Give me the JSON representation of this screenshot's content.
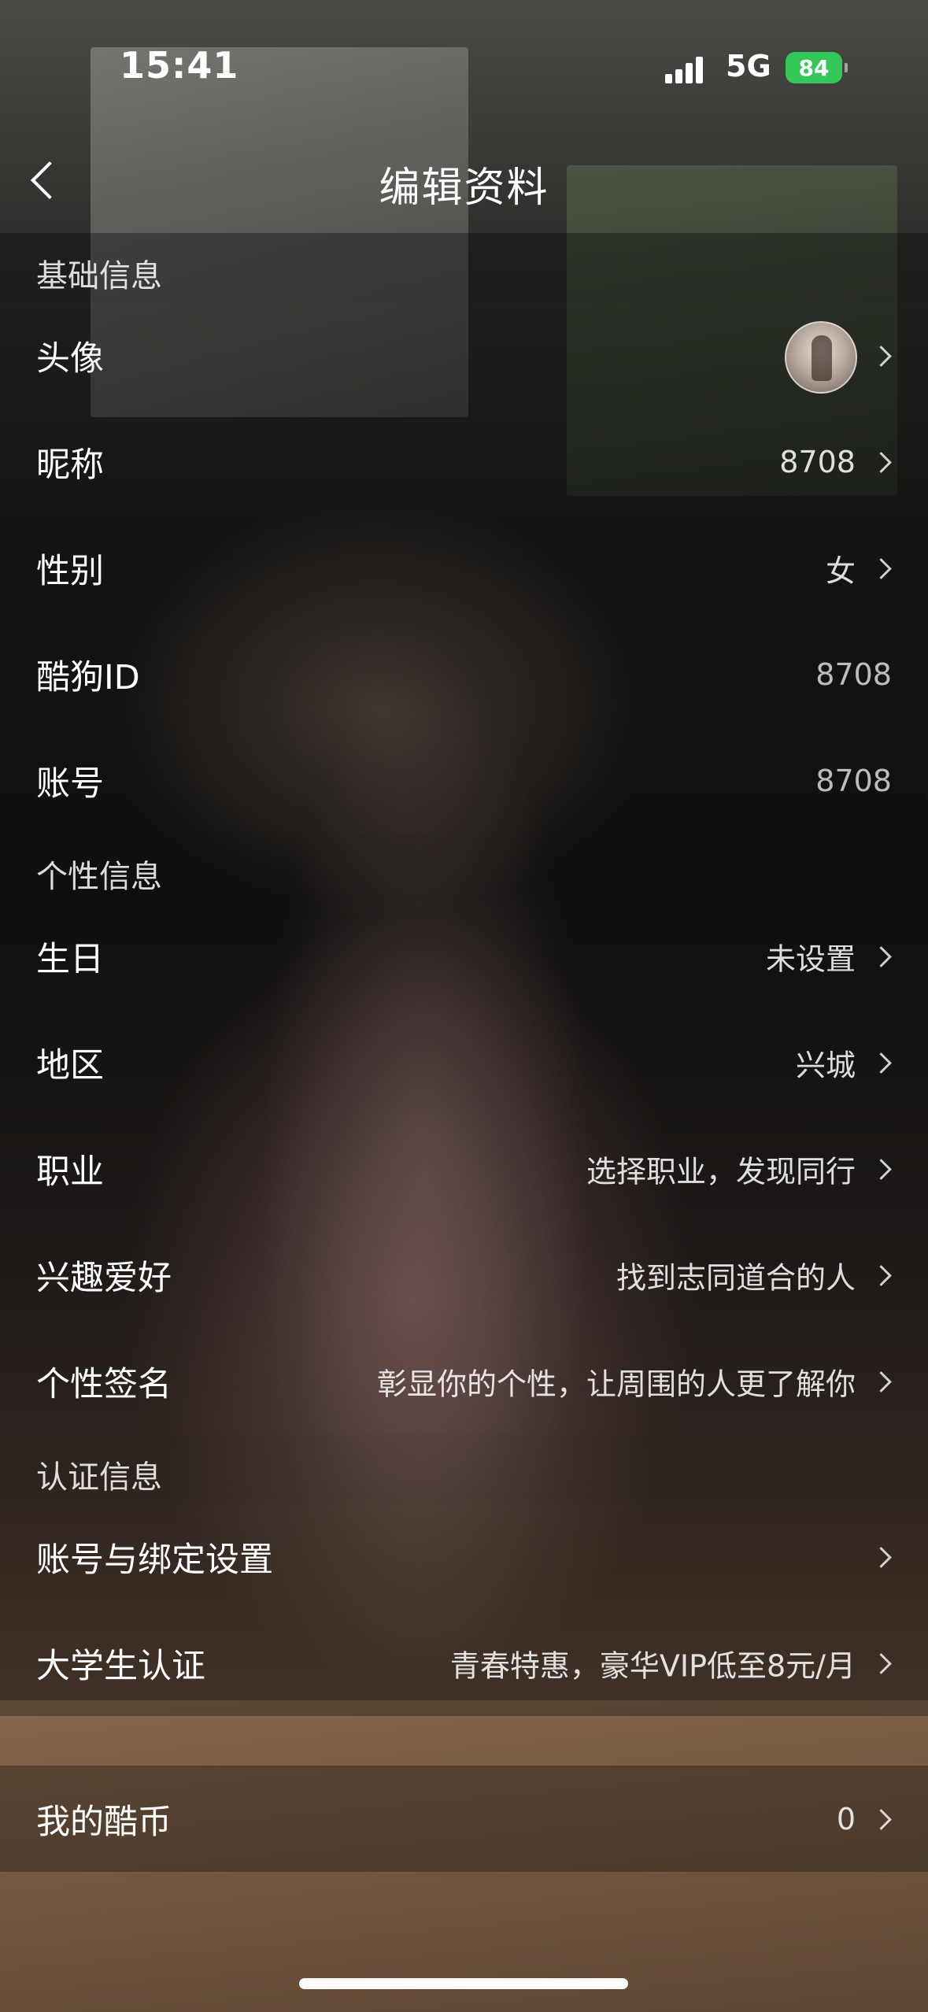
{
  "status_bar": {
    "time": "15:41",
    "network": "5G",
    "battery": "84",
    "battery_color": "#34c759"
  },
  "nav": {
    "title": "编辑资料",
    "back_icon": "chevron-left-icon"
  },
  "sections": {
    "basic": {
      "header": "基础信息",
      "avatar_label": "头像",
      "nickname_label": "昵称",
      "nickname_value": "8708",
      "gender_label": "性别",
      "gender_value": "女",
      "kugou_id_label": "酷狗ID",
      "kugou_id_value": "8708",
      "account_label": "账号",
      "account_value": "8708"
    },
    "personal": {
      "header": "个性信息",
      "birthday_label": "生日",
      "birthday_value": "未设置",
      "region_label": "地区",
      "region_value": "兴城",
      "job_label": "职业",
      "job_value": "选择职业，发现同行",
      "hobby_label": "兴趣爱好",
      "hobby_value": "找到志同道合的人",
      "signature_label": "个性签名",
      "signature_value": "彰显你的个性，让周围的人更了解你"
    },
    "verify": {
      "header": "认证信息",
      "binding_label": "账号与绑定设置",
      "student_label": "大学生认证",
      "student_value": "青春特惠，豪华VIP低至8元/月"
    },
    "coins": {
      "label": "我的酷币",
      "value": "0"
    }
  }
}
